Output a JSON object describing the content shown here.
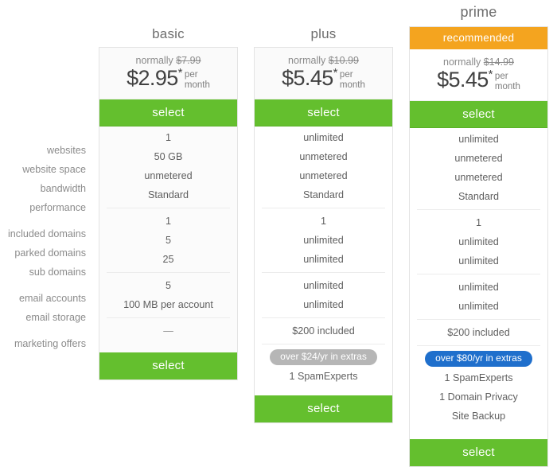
{
  "colors": {
    "green": "#64bf2e",
    "orange": "#f4a41f",
    "blue": "#1f6fcc",
    "gray_pill": "#b6b6b6",
    "text": "#5f5f5f",
    "label_text": "#8b8b8b",
    "card_border": "#e3e3e3"
  },
  "feature_labels": {
    "group1": [
      "websites",
      "website space",
      "bandwidth",
      "performance"
    ],
    "group2": [
      "included domains",
      "parked domains",
      "sub domains"
    ],
    "group3": [
      "email accounts",
      "email storage"
    ],
    "group4": [
      "marketing offers"
    ]
  },
  "buttons": {
    "select_label": "select"
  },
  "plans": [
    {
      "id": "basic",
      "title": "basic",
      "recommended_badge": null,
      "normally_prefix": "normally ",
      "normally_price": "$7.99",
      "price": "$2.95",
      "price_star": "*",
      "per_month": "per\nmonth",
      "group1": [
        "1",
        "50 GB",
        "unmetered",
        "Standard"
      ],
      "group2": [
        "1",
        "5",
        "25"
      ],
      "group3": [
        "5",
        "100 MB per account"
      ],
      "group4": [
        "—"
      ],
      "extras_pill": null,
      "extras_items": []
    },
    {
      "id": "plus",
      "title": "plus",
      "recommended_badge": null,
      "normally_prefix": "normally ",
      "normally_price": "$10.99",
      "price": "$5.45",
      "price_star": "*",
      "per_month": "per\nmonth",
      "group1": [
        "unlimited",
        "unmetered",
        "unmetered",
        "Standard"
      ],
      "group2": [
        "1",
        "unlimited",
        "unlimited"
      ],
      "group3": [
        "unlimited",
        "unlimited"
      ],
      "group4": [
        "$200 included"
      ],
      "extras_pill": "over $24/yr in extras",
      "extras_items": [
        "1 SpamExperts"
      ]
    },
    {
      "id": "prime",
      "title": "prime",
      "recommended_badge": "recommended",
      "normally_prefix": "normally ",
      "normally_price": "$14.99",
      "price": "$5.45",
      "price_star": "*",
      "per_month": "per\nmonth",
      "group1": [
        "unlimited",
        "unmetered",
        "unmetered",
        "Standard"
      ],
      "group2": [
        "1",
        "unlimited",
        "unlimited"
      ],
      "group3": [
        "unlimited",
        "unlimited"
      ],
      "group4": [
        "$200 included"
      ],
      "extras_pill": "over $80/yr in extras",
      "extras_items": [
        "1 SpamExperts",
        "1 Domain Privacy",
        "Site Backup"
      ]
    }
  ]
}
